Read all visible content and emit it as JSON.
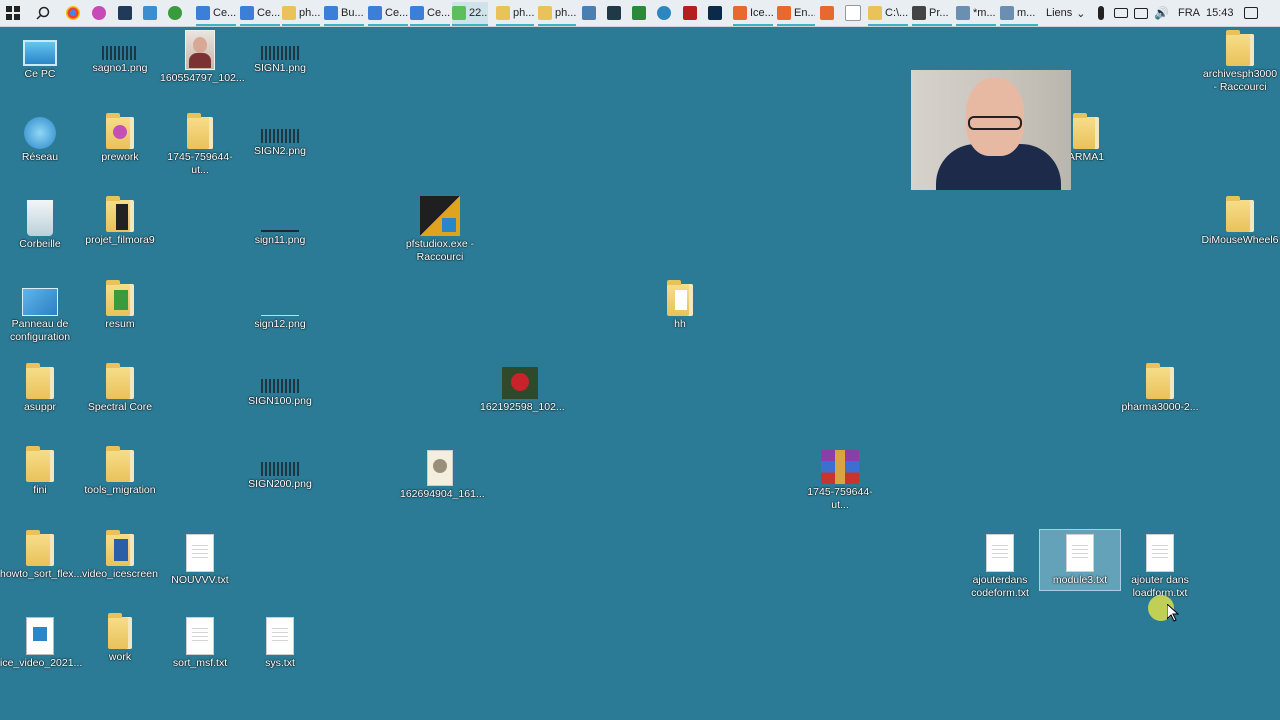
{
  "taskbar": {
    "items": [
      "Ce...",
      "Ce...",
      "ph...",
      "Bu...",
      "Ce...",
      "Ce...",
      "22...",
      "ph...",
      "ph...",
      "Ice...",
      "En...",
      "C:\\...",
      "Pr...",
      "*m...",
      "m..."
    ],
    "links_label": "Liens",
    "language": "FRA",
    "time": "15:43"
  },
  "desktop": {
    "icons": {
      "ce_pc": "Ce PC",
      "reseau": "Réseau",
      "corbeille": "Corbeille",
      "panneau": "Panneau de configuration",
      "asuppr": "asuppr",
      "fini": "fini",
      "howto": "howto_sort_flex...",
      "ice_video": "ice_video_2021...",
      "sagno": "sagno1.png",
      "prework": "prework",
      "projet_filmora": "projet_filmora9",
      "resum": "resum",
      "spectral": "Spectral Core",
      "tools_migration": "tools_migration",
      "video_icescreen": "video_icescreen",
      "work": "work",
      "img160554797": "160554797_102...",
      "folder1745": "1745-759644-ut...",
      "nouvvv": "NOUVVV.txt",
      "sort_msf": "sort_msf.txt",
      "sign1": "SIGN1.png",
      "sign2": "SIGN2.png",
      "sign11": "sign11.png",
      "sign12": "sign12.png",
      "sign100": "SIGN100.png",
      "sign200": "SIGN200.png",
      "sys": "sys.txt",
      "pfstudiox": "pfstudiox.exe - Raccourci",
      "img162694904": "162694904_161...",
      "img162192598": "162192598_102...",
      "hh": "hh",
      "rar1745": "1745-759644-ut...",
      "ajouterdans_codeform": "ajouterdans codeform.txt",
      "module3": "module3.txt",
      "ajouter_loadform": "ajouter dans loadform.txt",
      "pharma3000": "pharma3000-2...",
      "arma1": "ARMA1",
      "archivesph": "archivesph3000 - Raccourci",
      "dimousewheel": "DiMouseWheel6"
    }
  },
  "colors": {
    "desktop_bg": "#2b7b96",
    "taskbar_bg": "#e9eef2",
    "accent": "#3ab4c3"
  }
}
